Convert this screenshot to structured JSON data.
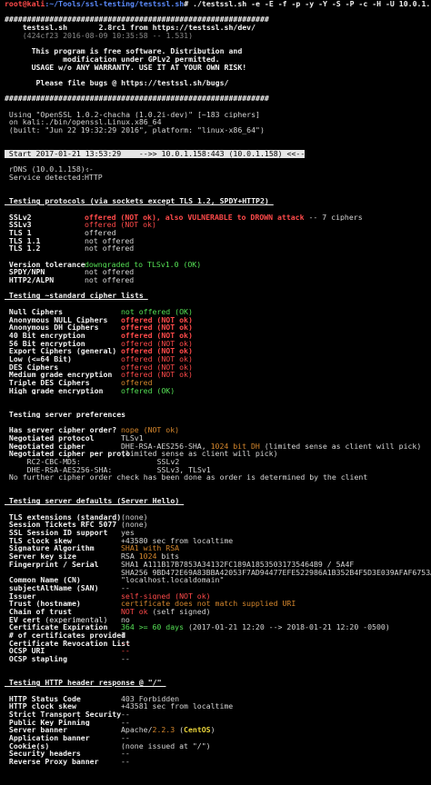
{
  "prompt": {
    "user_host": "root@kali",
    "path": ":~/Tools/ssl-testing/testssl.sh",
    "command": "# ./testssl.sh -e -E -f -p -y -Y -S -P -c -H -U 10.0.1.158"
  },
  "banner": {
    "hashes": "###########################################################",
    "line1": "    testssl.sh       2.8rc1 from https://testssl.sh/dev/",
    "line2": "    (424cf23 2016-08-09 10:35:58 -- 1.531)",
    "line3": "      This program is free software. Distribution and",
    "line4": "             modification under GPLv2 permitted.",
    "line5": "      USAGE w/o ANY WARRANTY. USE IT AT YOUR OWN RISK!",
    "line6": "       Please file bugs @ https://testssl.sh/bugs/"
  },
  "openssl": {
    "line1": " Using \"OpenSSL 1.0.2-chacha (1.0.2i-dev)\" [~183 ciphers]",
    "line2": " on kali:./bin/openssl.Linux.x86_64",
    "line3": " (built: \"Jun 22 19:32:29 2016\", platform: \"linux-x86_64\")"
  },
  "start": {
    "text": " Start 2017-01-21 13:53:29    -->> 10.0.1.158:443 (10.0.1.158) <<--"
  },
  "rdns": {
    "label": " rDNS (10.0.1.158):",
    "value": "--"
  },
  "service": {
    "label": " Service detected:",
    "value": "HTTP"
  },
  "protocols": {
    "heading": " Testing protocols (via sockets except TLS 1.2, SPDY+HTTP2) ",
    "items": [
      {
        "name": " SSLv2",
        "value": "offered (NOT ok), also VULNERABLE to DROWN attack",
        "extra": " -- 7 ciphers",
        "cls": "bred"
      },
      {
        "name": " SSLv3",
        "value": "offered (NOT ok)",
        "extra": "",
        "cls": "red"
      },
      {
        "name": " TLS 1",
        "value": "offered",
        "extra": "",
        "cls": ""
      },
      {
        "name": " TLS 1.1",
        "value": "not offered",
        "extra": "",
        "cls": ""
      },
      {
        "name": " TLS 1.2",
        "value": "not offered",
        "extra": "",
        "cls": ""
      }
    ],
    "items2": [
      {
        "name": " Version tolerance",
        "value": "downgraded to TLSv1.0 (OK)",
        "cls": "green"
      },
      {
        "name": " SPDY/NPN",
        "value": "not offered",
        "cls": ""
      },
      {
        "name": " HTTP2/ALPN",
        "value": "not offered",
        "cls": ""
      }
    ]
  },
  "ciphers": {
    "heading": " Testing ~standard cipher lists ",
    "items": [
      {
        "name": " Null Ciphers",
        "value": "not offered (OK)",
        "cls": "green"
      },
      {
        "name": " Anonymous NULL Ciphers",
        "value": "offered (NOT ok)",
        "cls": "bred"
      },
      {
        "name": " Anonymous DH Ciphers",
        "value": "offered (NOT ok)",
        "cls": "bred"
      },
      {
        "name": " 40 Bit encryption",
        "value": "offered (NOT ok)",
        "cls": "bred"
      },
      {
        "name": " 56 Bit encryption",
        "value": "offered (NOT ok)",
        "cls": "red"
      },
      {
        "name": " Export Ciphers (general)",
        "value": "offered (NOT ok)",
        "cls": "bred"
      },
      {
        "name": " Low (<=64 Bit)",
        "value": "offered (NOT ok)",
        "cls": "red"
      },
      {
        "name": " DES Ciphers",
        "value": "offered (NOT ok)",
        "cls": "red"
      },
      {
        "name": " Medium grade encryption",
        "value": "offered (NOT ok)",
        "cls": "red"
      },
      {
        "name": " Triple DES Ciphers",
        "value": "offered",
        "cls": "orange"
      },
      {
        "name": " High grade encryption",
        "value": "offered (OK)",
        "cls": "green"
      }
    ]
  },
  "prefs": {
    "heading": " Testing server preferences ",
    "items": [
      {
        "name": " Has server cipher order?",
        "value": "nope (NOT ok)",
        "cls": "orange"
      },
      {
        "name": " Negotiated protocol",
        "value": "TLSv1",
        "cls": ""
      },
      {
        "name": " Negotiated cipher",
        "value": "DHE-RSA-AES256-SHA, ",
        "value2": "1024 bit DH",
        "value3": " (limited sense as client will pick)",
        "cls": ""
      },
      {
        "name": " Negotiated cipher per proto",
        "value": "(limited sense as client will pick)",
        "cls": ""
      }
    ],
    "sub1": "     RC2-CBC-MD5:                 SSLv2",
    "sub2": "     DHE-RSA-AES256-SHA:          SSLv3, TLSv1",
    "note": " No further cipher order check has been done as order is determined by the client"
  },
  "defaults": {
    "heading": " Testing server defaults (Server Hello) ",
    "items": [
      {
        "name": " TLS extensions (standard)",
        "value": "(none)",
        "cls": ""
      },
      {
        "name": " Session Tickets RFC 5077",
        "value": "(none)",
        "cls": ""
      },
      {
        "name": " SSL Session ID support",
        "value": "yes",
        "cls": ""
      },
      {
        "name": " TLS clock skew",
        "value": "+43580 sec from localtime",
        "cls": ""
      },
      {
        "name": " Signature Algorithm",
        "value": "SHA1 with RSA",
        "cls": "orange"
      },
      {
        "name": " Server key size",
        "value": "RSA ",
        "value2": "1024",
        "value3": " bits",
        "cls": ""
      },
      {
        "name": " Fingerprint / Serial",
        "value": "SHA1 A111B17B7853A34132FC189A18535031735464B9 / 5A4F",
        "cls": ""
      },
      {
        "name": "",
        "value": "SHA256 9BD472E69A83BBA42053F7AD94477EFE522986A1B352B4F5D3E039AFAF6753AB",
        "cls": ""
      },
      {
        "name": " Common Name (CN)",
        "value": "\"localhost.localdomain\"",
        "cls": ""
      },
      {
        "name": " subjectAltName (SAN)",
        "value": "--",
        "cls": ""
      },
      {
        "name": " Issuer",
        "value": "self-signed (NOT ok)",
        "cls": "red"
      },
      {
        "name": " Trust (hostname)",
        "value": "certificate does not match supplied URI",
        "cls": "orange"
      },
      {
        "name": " Chain of trust",
        "value": "NOT ok",
        "value3": " (self signed)",
        "cls": "red"
      },
      {
        "name": " EV cert",
        "namesuffix": " (experimental)",
        "value": "no",
        "cls": ""
      },
      {
        "name": " Certificate Expiration",
        "value": "364 >= 60 days",
        "value3": " (2017-01-21 12:20 --> 2018-01-21 12:20 -0500)",
        "cls": "green"
      },
      {
        "name": " # of certificates provided",
        "value": "1",
        "cls": ""
      },
      {
        "name": " Certificate Revocation List",
        "value": "--",
        "cls": "red"
      },
      {
        "name": " OCSP URI",
        "value": "--",
        "cls": "red"
      },
      {
        "name": " OCSP stapling",
        "value": "--",
        "cls": ""
      }
    ]
  },
  "http": {
    "heading": " Testing HTTP header response @ \"/\" ",
    "items": [
      {
        "name": " HTTP Status Code",
        "value": "403 Forbidden",
        "cls": ""
      },
      {
        "name": " HTTP clock skew",
        "value": "+43581 sec from localtime",
        "cls": ""
      },
      {
        "name": " Strict Transport Security",
        "value": "--",
        "cls": ""
      },
      {
        "name": " Public Key Pinning",
        "value": "--",
        "cls": ""
      },
      {
        "name": " Server banner",
        "value": "Apache/",
        "value2": "2.2.3",
        "value3": " (",
        "value4": "CentOS",
        "value5": ")",
        "cls": ""
      },
      {
        "name": " Application banner",
        "value": "--",
        "cls": ""
      },
      {
        "name": " Cookie(s)",
        "value": "(none issued at \"/\")",
        "cls": ""
      },
      {
        "name": " Security headers",
        "value": "--",
        "cls": ""
      },
      {
        "name": " Reverse Proxy banner",
        "value": "--",
        "cls": ""
      }
    ]
  }
}
